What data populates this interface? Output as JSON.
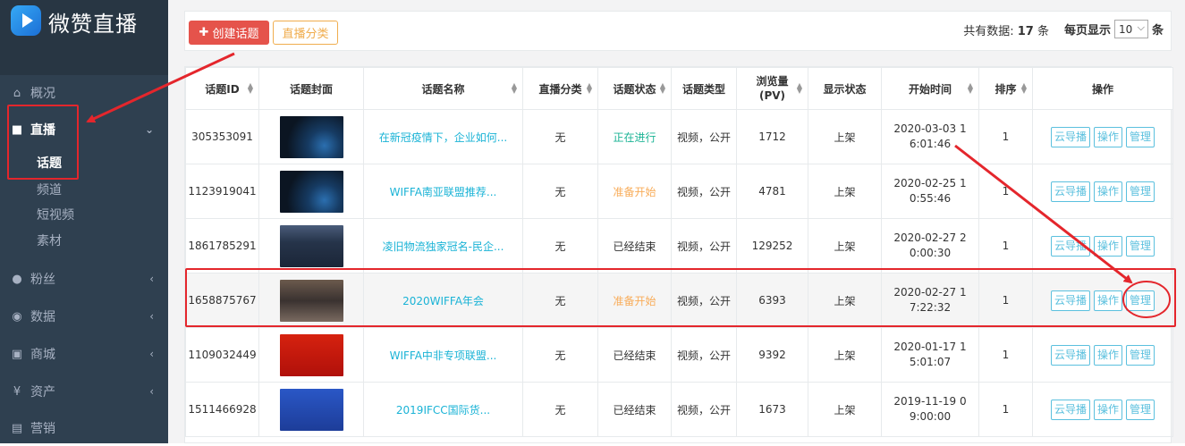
{
  "app": {
    "title": "微赞直播"
  },
  "sidebar": {
    "items": [
      {
        "label": "概况",
        "icon": "home-icon"
      },
      {
        "label": "直播",
        "icon": "video-camera-icon"
      },
      {
        "label": "粉丝",
        "icon": "user-icon"
      },
      {
        "label": "数据",
        "icon": "eye-icon"
      },
      {
        "label": "商城",
        "icon": "shop-icon"
      },
      {
        "label": "资产",
        "icon": "yen-icon"
      },
      {
        "label": "营销",
        "icon": "ticket-icon"
      }
    ],
    "live_sub": [
      "话题",
      "频道",
      "短视频",
      "素材"
    ]
  },
  "toolbar": {
    "create_label": "创建话题",
    "category_label": "直播分类"
  },
  "pagination": {
    "total_prefix": "共有数据:",
    "total_count": "17",
    "total_suffix": "条",
    "per_page_label": "每页显示",
    "per_page_value": "10",
    "per_page_suffix": "条"
  },
  "table": {
    "headers": [
      "话题ID",
      "话题封面",
      "话题名称",
      "直播分类",
      "话题状态",
      "话题类型",
      "浏览量 (PV)",
      "显示状态",
      "开始时间",
      "排序",
      "操作"
    ],
    "op_labels": [
      "云导播",
      "操作",
      "管理"
    ],
    "rows": [
      {
        "id": "305353091",
        "name": "在新冠疫情下，企业如何...",
        "category": "无",
        "status": "正在进行",
        "type": "视频，公开",
        "pv": "1712",
        "display": "上架",
        "start": "2020-03-03 16:01:46",
        "sort": "1"
      },
      {
        "id": "1123919041",
        "name": "WIFFA南亚联盟推荐...",
        "category": "无",
        "status": "准备开始",
        "type": "视频，公开",
        "pv": "4781",
        "display": "上架",
        "start": "2020-02-25 10:55:46",
        "sort": "1"
      },
      {
        "id": "1861785291",
        "name": "凌旧物流独家冠名-民企...",
        "category": "无",
        "status": "已经结束",
        "type": "视频，公开",
        "pv": "129252",
        "display": "上架",
        "start": "2020-02-27 20:00:30",
        "sort": "1"
      },
      {
        "id": "1658875767",
        "name": "2020WIFFA年会",
        "category": "无",
        "status": "准备开始",
        "type": "视频，公开",
        "pv": "6393",
        "display": "上架",
        "start": "2020-02-27 17:22:32",
        "sort": "1"
      },
      {
        "id": "1109032449",
        "name": "WIFFA中非专项联盟...",
        "category": "无",
        "status": "已经结束",
        "type": "视频，公开",
        "pv": "9392",
        "display": "上架",
        "start": "2020-01-17 15:01:07",
        "sort": "1"
      },
      {
        "id": "1511466928",
        "name": "2019IFCC国际货...",
        "category": "无",
        "status": "已经结束",
        "type": "视频，公开",
        "pv": "1673",
        "display": "上架",
        "start": "2019-11-19 09:00:00",
        "sort": "1"
      }
    ]
  },
  "colors": {
    "annotation": "#e4262c",
    "link": "#1ab3d6",
    "sidebar_bg": "#2f4050"
  }
}
